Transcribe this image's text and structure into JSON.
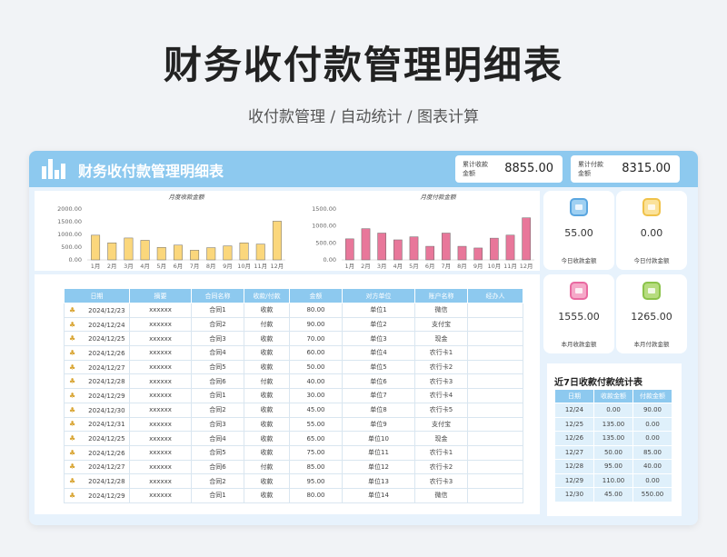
{
  "page": {
    "title": "财务收付款管理明细表",
    "subtitle": "收付款管理 / 自动统计 / 图表计算"
  },
  "header": {
    "title": "财务收付款管理明细表",
    "receipt_label": "累计收款金额",
    "receipt_value": "8855.00",
    "payment_label": "累计付款金额",
    "payment_value": "8315.00"
  },
  "colors": {
    "header": "#8dc9ef",
    "receipt_bar": "#fbd77c",
    "payment_bar": "#e8779a",
    "icon_blue": "#5aa6e0",
    "icon_yellow": "#f0c24a",
    "icon_pink": "#e96aa1",
    "icon_green": "#8bc34a"
  },
  "chart_data": [
    {
      "type": "bar",
      "title": "月度收款金额",
      "categories": [
        "1月",
        "2月",
        "3月",
        "4月",
        "5月",
        "6月",
        "7月",
        "8月",
        "9月",
        "10月",
        "11月",
        "12月"
      ],
      "values": [
        970,
        670,
        860,
        770,
        490,
        580,
        380,
        480,
        550,
        670,
        620,
        1520
      ],
      "yticks": [
        "0.00",
        "500.00",
        "1000.00",
        "1500.00",
        "2000.00"
      ],
      "ylim": [
        0,
        2000
      ],
      "color": "#fbd77c"
    },
    {
      "type": "bar",
      "title": "月度付款金额",
      "categories": [
        "1月",
        "2月",
        "3月",
        "4月",
        "5月",
        "6月",
        "7月",
        "8月",
        "9月",
        "10月",
        "11月",
        "12月"
      ],
      "values": [
        620,
        920,
        790,
        590,
        680,
        400,
        790,
        400,
        350,
        640,
        730,
        1240
      ],
      "yticks": [
        "0.00",
        "500.00",
        "1000.00",
        "1500.00"
      ],
      "ylim": [
        0,
        1500
      ],
      "color": "#e8779a"
    }
  ],
  "table": {
    "headers": [
      "日期",
      "摘要",
      "合同名称",
      "收款/付款",
      "金额",
      "对方单位",
      "账户名称",
      "经办人"
    ],
    "rows": [
      [
        "2024/12/23",
        "xxxxxx",
        "合同1",
        "收款",
        "80.00",
        "单位1",
        "微信",
        ""
      ],
      [
        "2024/12/24",
        "xxxxxx",
        "合同2",
        "付款",
        "90.00",
        "单位2",
        "支付宝",
        ""
      ],
      [
        "2024/12/25",
        "xxxxxx",
        "合同3",
        "收款",
        "70.00",
        "单位3",
        "现金",
        ""
      ],
      [
        "2024/12/26",
        "xxxxxx",
        "合同4",
        "收款",
        "60.00",
        "单位4",
        "农行卡1",
        ""
      ],
      [
        "2024/12/27",
        "xxxxxx",
        "合同5",
        "收款",
        "50.00",
        "单位5",
        "农行卡2",
        ""
      ],
      [
        "2024/12/28",
        "xxxxxx",
        "合同6",
        "付款",
        "40.00",
        "单位6",
        "农行卡3",
        ""
      ],
      [
        "2024/12/29",
        "xxxxxx",
        "合同1",
        "收款",
        "30.00",
        "单位7",
        "农行卡4",
        ""
      ],
      [
        "2024/12/30",
        "xxxxxx",
        "合同2",
        "收款",
        "45.00",
        "单位8",
        "农行卡5",
        ""
      ],
      [
        "2024/12/31",
        "xxxxxx",
        "合同3",
        "收款",
        "55.00",
        "单位9",
        "支付宝",
        ""
      ],
      [
        "2024/12/25",
        "xxxxxx",
        "合同4",
        "收款",
        "65.00",
        "单位10",
        "现金",
        ""
      ],
      [
        "2024/12/26",
        "xxxxxx",
        "合同5",
        "收款",
        "75.00",
        "单位11",
        "农行卡1",
        ""
      ],
      [
        "2024/12/27",
        "xxxxxx",
        "合同6",
        "付款",
        "85.00",
        "单位12",
        "农行卡2",
        ""
      ],
      [
        "2024/12/28",
        "xxxxxx",
        "合同2",
        "收款",
        "95.00",
        "单位13",
        "农行卡3",
        ""
      ],
      [
        "2024/12/29",
        "xxxxxx",
        "合同1",
        "收款",
        "80.00",
        "单位14",
        "微信",
        ""
      ]
    ],
    "row_icons": [
      "receipt-icon",
      "payment-icon",
      "receipt-icon",
      "receipt-icon",
      "receipt-icon",
      "payment-icon",
      "receipt-icon",
      "receipt-icon",
      "receipt-icon",
      "receipt-icon",
      "receipt-icon",
      "payment-icon",
      "receipt-icon",
      "receipt-icon"
    ]
  },
  "tiles": [
    {
      "value": "55.00",
      "label": "今日收款金额",
      "icon": "wallet-icon",
      "color": "#5aa6e0"
    },
    {
      "value": "0.00",
      "label": "今日付款金额",
      "icon": "wallet-icon",
      "color": "#f0c24a"
    },
    {
      "value": "1555.00",
      "label": "本月收款金额",
      "icon": "wallet-icon",
      "color": "#e96aa1"
    },
    {
      "value": "1265.00",
      "label": "本月付款金额",
      "icon": "wallet-icon",
      "color": "#8bc34a"
    }
  ],
  "week": {
    "title": "近7日收款付款统计表",
    "headers": [
      "日期",
      "收款金额",
      "付款金额"
    ],
    "rows": [
      [
        "12/24",
        "0.00",
        "90.00"
      ],
      [
        "12/25",
        "135.00",
        "0.00"
      ],
      [
        "12/26",
        "135.00",
        "0.00"
      ],
      [
        "12/27",
        "50.00",
        "85.00"
      ],
      [
        "12/28",
        "95.00",
        "40.00"
      ],
      [
        "12/29",
        "110.00",
        "0.00"
      ],
      [
        "12/30",
        "45.00",
        "550.00"
      ]
    ]
  }
}
